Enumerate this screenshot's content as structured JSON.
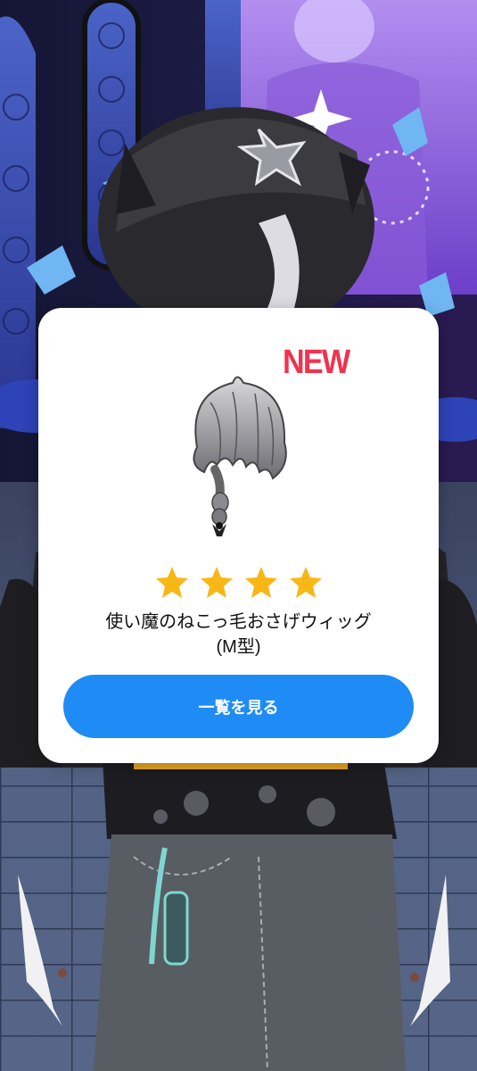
{
  "dialog": {
    "badge_text": "NEW",
    "item_name_line1": "使い魔のねこっ毛おさげウィッグ",
    "item_name_line2": "(M型)",
    "rarity_stars": 4,
    "button_label": "一覧を見る",
    "item_image_icon": "braided-wig-icon",
    "star_icon": "star-icon"
  },
  "colors": {
    "badge": "#f0334f",
    "star": "#f7b817",
    "button": "#1f8cf5",
    "button_text": "#ffffff"
  }
}
